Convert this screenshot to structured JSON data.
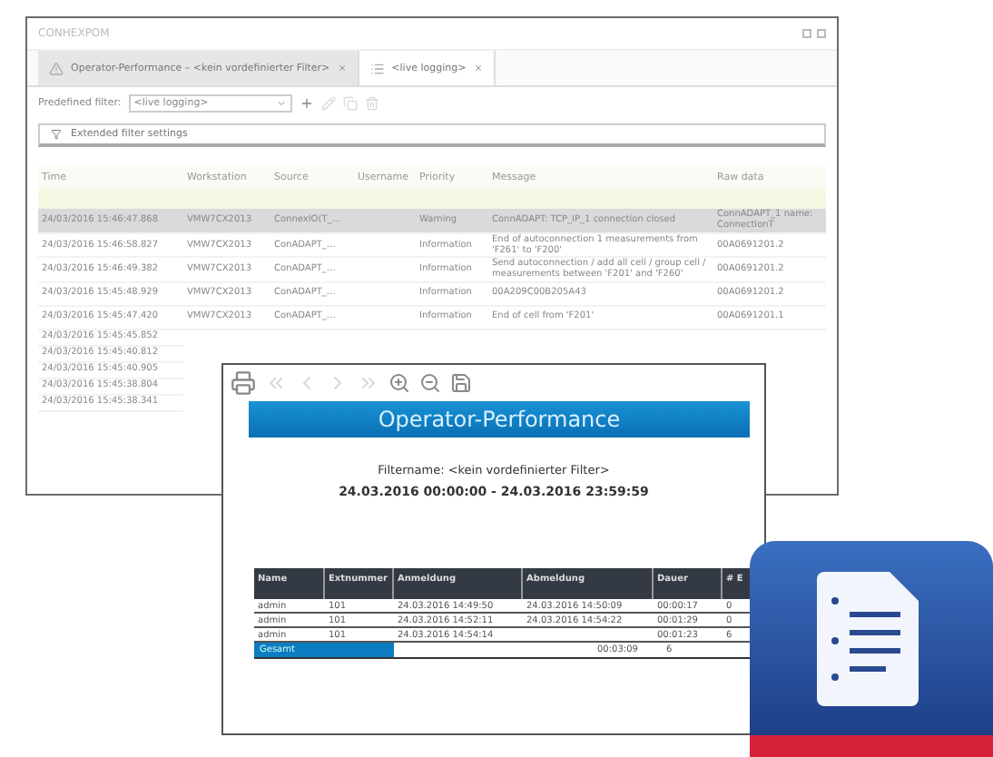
{
  "log_window": {
    "title": "CONHEXPOM",
    "tabs": [
      {
        "label": "Operator-Performance – <kein vordefinierter Filter>",
        "kind": "report",
        "selected": false
      },
      {
        "label": "<live logging>",
        "kind": "log",
        "selected": true
      }
    ],
    "filter": {
      "label": "Predefined filter:",
      "value": "<live logging>",
      "tools": [
        {
          "kind": "add",
          "disabled": false
        },
        {
          "kind": "edit",
          "disabled": true
        },
        {
          "kind": "copy",
          "disabled": true
        },
        {
          "kind": "delete",
          "disabled": true
        }
      ]
    },
    "extended_filter": {
      "label": "Extended filter settings",
      "expanded": false
    },
    "table": {
      "columns": [
        "Time",
        "Workstation",
        "Source",
        "Username",
        "Priority",
        "Message",
        "Raw data"
      ],
      "rows": [
        {
          "selected": true,
          "cells": [
            "24/03/2016 15:46:47.868",
            "VMW7CX2013",
            "ConnexIO(T_...",
            "",
            "Warning",
            "ConnADAPT: TCP_IP_1 connection closed",
            "ConnADAPT_1 name: ConnectionT"
          ]
        },
        {
          "selected": false,
          "cells": [
            "24/03/2016 15:46:58.827",
            "VMW7CX2013",
            "ConADAPT_...",
            "",
            "Information",
            "End of autoconnection 1 measurements from 'F261' to 'F200'",
            "00A0691201.2"
          ]
        },
        {
          "selected": false,
          "cells": [
            "24/03/2016 15:46:49.382",
            "VMW7CX2013",
            "ConADAPT_...",
            "",
            "Information",
            "Send autoconnection / add all cell / group cell / measurements between 'F201' and 'F260'",
            "00A0691201.2"
          ]
        },
        {
          "selected": false,
          "cells": [
            "24/03/2016 15:45:48.929",
            "VMW7CX2013",
            "ConADAPT_...",
            "",
            "Information",
            "00A209C00B205A43",
            "00A0691201.2"
          ]
        },
        {
          "selected": false,
          "cells": [
            "24/03/2016 15:45:47.420",
            "VMW7CX2013",
            "ConADAPT_...",
            "",
            "Information",
            "End of cell from 'F201'",
            "00A0691201.1"
          ]
        },
        {
          "selected": false,
          "cells": [
            "24/03/2016 15:45:45.852"
          ]
        },
        {
          "selected": false,
          "cells": [
            "24/03/2016 15:45:40.812"
          ]
        },
        {
          "selected": false,
          "cells": [
            "24/03/2016 15:45:40.905"
          ]
        },
        {
          "selected": false,
          "cells": [
            "24/03/2016 15:45:38.804"
          ]
        },
        {
          "selected": false,
          "cells": [
            "24/03/2016 15:45:38.341"
          ]
        }
      ]
    }
  },
  "report_window": {
    "toolbar": [
      {
        "kind": "print",
        "disabled": false
      },
      {
        "kind": "first",
        "disabled": true
      },
      {
        "kind": "prev",
        "disabled": true
      },
      {
        "kind": "next",
        "disabled": true
      },
      {
        "kind": "last",
        "disabled": true
      },
      {
        "kind": "zoom-in",
        "disabled": false
      },
      {
        "kind": "zoom-out",
        "disabled": false
      },
      {
        "kind": "save",
        "disabled": false
      }
    ],
    "title": "Operator-Performance",
    "filter_name": "Filtername: <kein vordefinierter Filter>",
    "period": "24.03.2016 00:00:00 - 24.03.2016 23:59:59",
    "table": {
      "columns": [
        "Name",
        "Extnummer",
        "Anmeldung",
        "Abmeldung",
        "Dauer",
        "# E"
      ],
      "rows": [
        [
          "admin",
          "101",
          "24.03.2016 14:49:50",
          "24.03.2016 14:50:09",
          "00:00:17",
          "0"
        ],
        [
          "admin",
          "101",
          "24.03.2016 14:52:11",
          "24.03.2016 14:54:22",
          "00:01:29",
          "0"
        ],
        [
          "admin",
          "101",
          "24.03.2016 14:54:14",
          "",
          "00:01:23",
          "6"
        ]
      ],
      "total": {
        "label": "Gesamt",
        "duration": "00:03:09",
        "count": "6"
      }
    }
  }
}
